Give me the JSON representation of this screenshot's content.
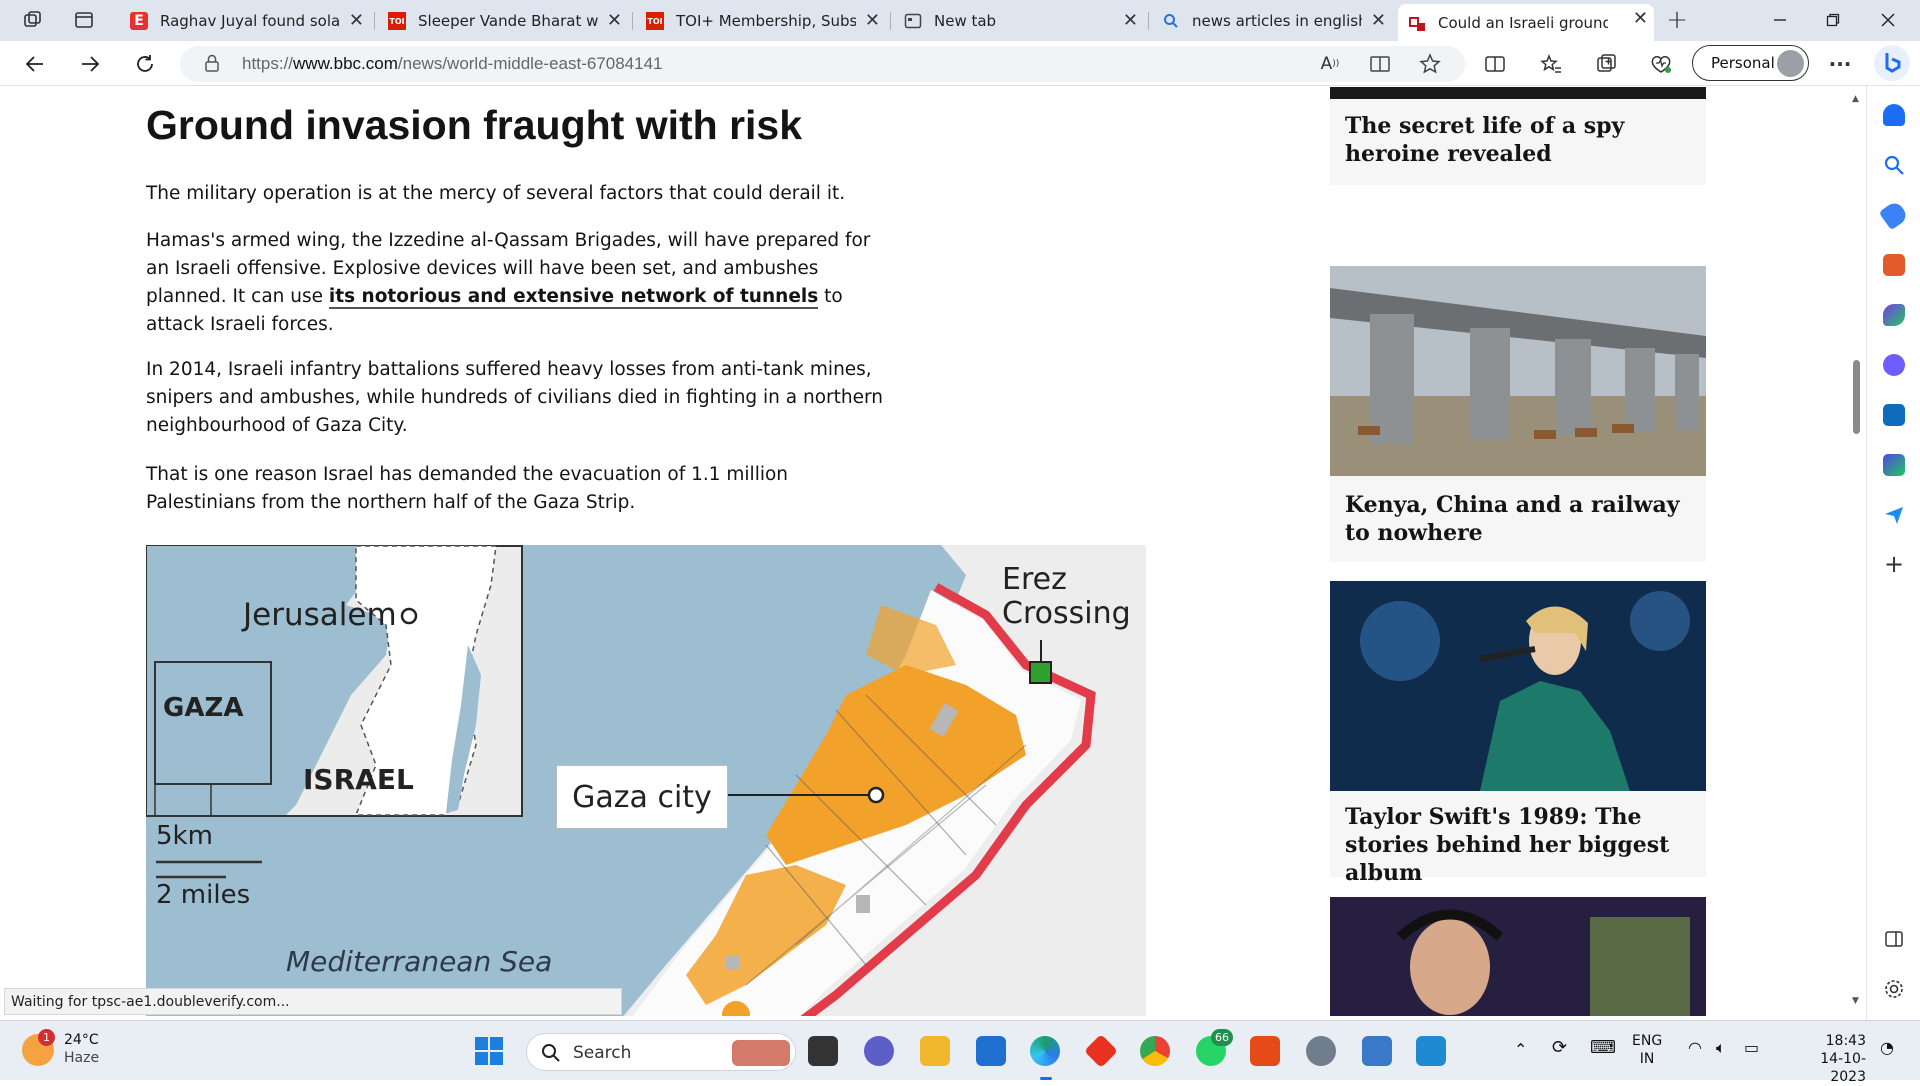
{
  "browser": {
    "tabs": [
      {
        "title": "Raghav Juyal found solace",
        "favicon": "E",
        "favicon_color": "#e8312f"
      },
      {
        "title": "Sleeper Vande Bharat will c",
        "favicon": "TOI",
        "favicon_color": "#d81e05"
      },
      {
        "title": "TOI+ Membership, Subscri",
        "favicon": "TOI",
        "favicon_color": "#d81e05"
      },
      {
        "title": "New tab",
        "favicon": "newtab-icon",
        "favicon_color": "#555555"
      },
      {
        "title": "news articles in english - S",
        "favicon": "search-icon",
        "favicon_color": "#2a6fdb"
      },
      {
        "title": "Could an Israeli ground in",
        "favicon": "bbc-icon",
        "favicon_color": "#bb1919",
        "active": true
      }
    ],
    "url_prefix": "https://",
    "url_host": "www.bbc.com",
    "url_path": "/news/world-middle-east-67084141",
    "profile_label": "Personal",
    "status_text": "Waiting for tpsc-ae1.doubleverify.com..."
  },
  "article": {
    "heading": "Ground invasion fraught with risk",
    "p1": "The military operation is at the mercy of several factors that could derail it.",
    "p2_before": "Hamas's armed wing, the Izzedine al-Qassam Brigades, will have prepared for an Israeli offensive. Explosive devices will have been set, and ambushes planned. It can use ",
    "p2_link": "its notorious and extensive network of tunnels",
    "p2_after": " to attack Israeli forces.",
    "p3": "In 2014, Israeli infantry battalions suffered heavy losses from anti-tank mines, snipers and ambushes, while hundreds of civilians died in fighting in a northern neighbourhood of Gaza City.",
    "p4": "That is one reason Israel has demanded the evacuation of 1.1 million Palestinians from the northern half of the Gaza Strip."
  },
  "map": {
    "jerusalem": "Jerusalem",
    "gaza": "GAZA",
    "israel": "ISRAEL",
    "scale_km": "5km",
    "scale_miles": "2 miles",
    "sea": "Mediterranean Sea",
    "gaza_city": "Gaza city",
    "erez_1": "Erez",
    "erez_2": "Crossing"
  },
  "rail": {
    "card1": "The secret life of a spy heroine revealed",
    "card2": "Kenya, China and a railway to nowhere",
    "card3": "Taylor Swift's 1989: The stories behind her biggest album"
  },
  "taskbar": {
    "weather_temp": "24°C",
    "weather_desc": "Haze",
    "weather_badge": "1",
    "search_label": "Search",
    "whatsapp_badge": "66",
    "lang_1": "ENG",
    "lang_2": "IN",
    "time": "18:43",
    "date": "14-10-2023"
  }
}
